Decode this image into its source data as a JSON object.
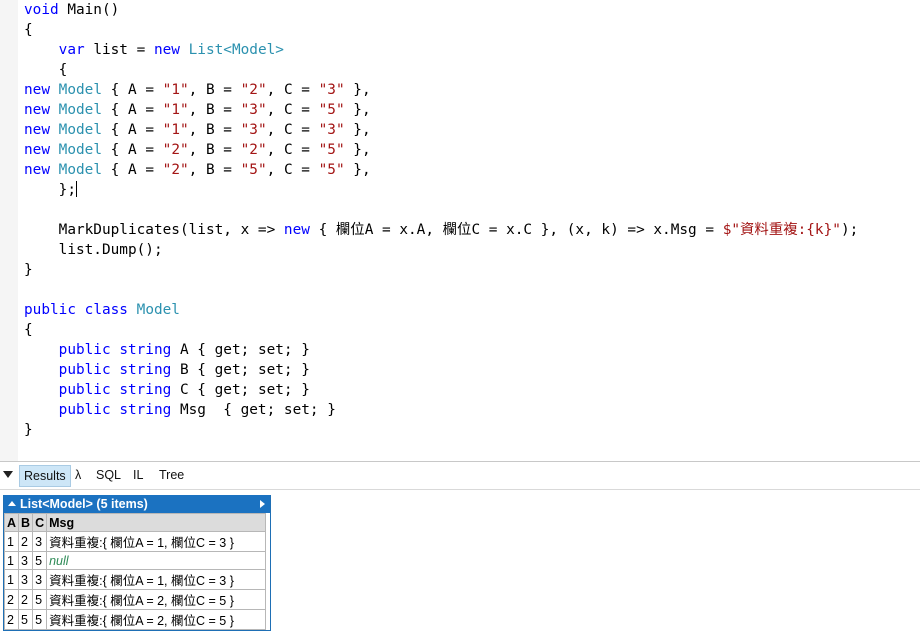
{
  "editor": {
    "lines": {
      "l1": [
        "void",
        " Main()"
      ],
      "l2": "{",
      "l3": [
        "var",
        " list = ",
        "new",
        " ",
        "List",
        "<",
        "Model",
        ">"
      ],
      "l4": "{",
      "rows": [
        {
          "a": "\"1\"",
          "b": "\"2\"",
          "c": "\"3\""
        },
        {
          "a": "\"1\"",
          "b": "\"3\"",
          "c": "\"5\""
        },
        {
          "a": "\"1\"",
          "b": "\"3\"",
          "c": "\"3\""
        },
        {
          "a": "\"2\"",
          "b": "\"2\"",
          "c": "\"5\""
        },
        {
          "a": "\"2\"",
          "b": "\"5\"",
          "c": "\"5\""
        }
      ],
      "row_new": "new",
      "row_model": "Model",
      "row_open": " { A = ",
      "row_b": ", B = ",
      "row_c": ", C = ",
      "row_close": " },",
      "l10": "};",
      "l12a": "MarkDuplicates(list, x => ",
      "l12new": "new",
      "l12b": " { 欄位A = x.A, 欄位C = x.C }, (x, k) => x.Msg = ",
      "l12str": "$\"資料重複:{k}\"",
      "l12c": ");",
      "l13": "list.Dump();",
      "l14": "}",
      "l16": [
        "public",
        " ",
        "class",
        " ",
        "Model"
      ],
      "l17": "{",
      "props": [
        {
          "name": " A ",
          "tail": "{ get; set; }"
        },
        {
          "name": " B ",
          "tail": "{ get; set; }"
        },
        {
          "name": " C ",
          "tail": "{ get; set; }"
        },
        {
          "name": " Msg  ",
          "tail": "{ get; set; }"
        }
      ],
      "prop_public": "public",
      "prop_string": "string",
      "l22": "}"
    }
  },
  "tabs": {
    "results": "Results",
    "lambda": "λ",
    "sql": "SQL",
    "il": "IL",
    "tree": "Tree"
  },
  "results": {
    "header": "List<Model> (5 items)",
    "columns": [
      "A",
      "B",
      "C",
      "Msg"
    ],
    "rows": [
      {
        "a": "1",
        "b": "2",
        "c": "3",
        "msg": "資料重複:{ 欄位A = 1, 欄位C = 3 }"
      },
      {
        "a": "1",
        "b": "3",
        "c": "5",
        "msg": "null"
      },
      {
        "a": "1",
        "b": "3",
        "c": "3",
        "msg": "資料重複:{ 欄位A = 1, 欄位C = 3 }"
      },
      {
        "a": "2",
        "b": "2",
        "c": "5",
        "msg": "資料重複:{ 欄位A = 2, 欄位C = 5 }"
      },
      {
        "a": "2",
        "b": "5",
        "c": "5",
        "msg": "資料重複:{ 欄位A = 2, 欄位C = 5 }"
      }
    ]
  },
  "colors": {
    "keyword": "#0000ff",
    "type": "#2b91af",
    "string": "#a31515",
    "results_header": "#1b72c1",
    "null": "#2e8b57"
  }
}
